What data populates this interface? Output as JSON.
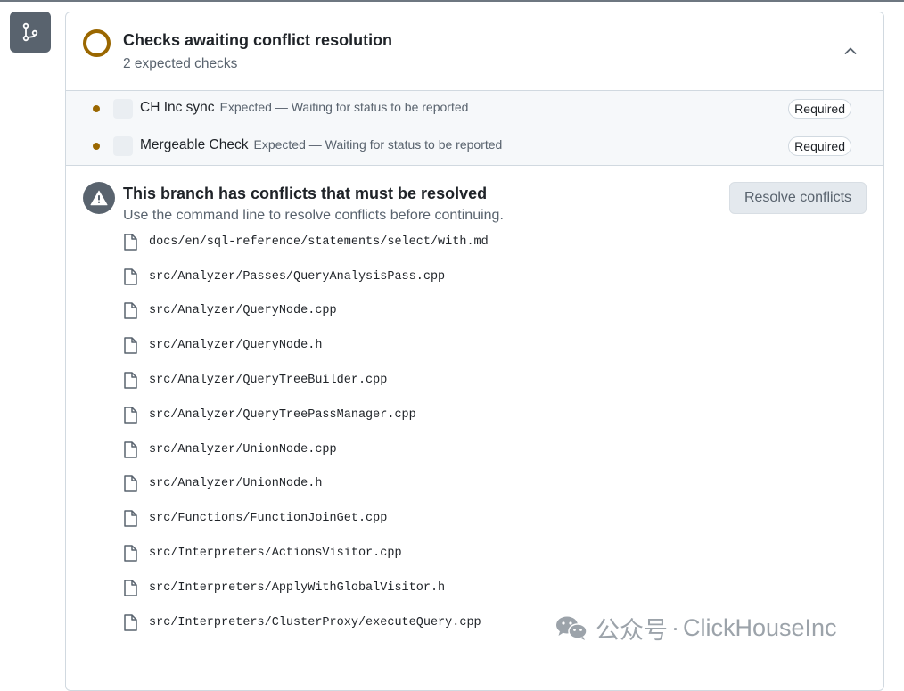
{
  "sidebar": {
    "icon": "git-branch-icon"
  },
  "checks_header": {
    "title": "Checks awaiting conflict resolution",
    "subtitle": "2 expected checks",
    "status_color": "#9a6700",
    "collapse_icon": "chevron-up-icon"
  },
  "checks": [
    {
      "name": "CH Inc sync",
      "status": "Expected — Waiting for status to be reported",
      "badge": "Required"
    },
    {
      "name": "Mergeable Check",
      "status": "Expected — Waiting for status to be reported",
      "badge": "Required"
    }
  ],
  "conflicts": {
    "icon": "alert-icon",
    "title": "This branch has conflicts that must be resolved",
    "subtitle": "Use the command line to resolve conflicts before continuing.",
    "button_label": "Resolve conflicts",
    "files": [
      "docs/en/sql-reference/statements/select/with.md",
      "src/Analyzer/Passes/QueryAnalysisPass.cpp",
      "src/Analyzer/QueryNode.cpp",
      "src/Analyzer/QueryNode.h",
      "src/Analyzer/QueryTreeBuilder.cpp",
      "src/Analyzer/QueryTreePassManager.cpp",
      "src/Analyzer/UnionNode.cpp",
      "src/Analyzer/UnionNode.h",
      "src/Functions/FunctionJoinGet.cpp",
      "src/Interpreters/ActionsVisitor.cpp",
      "src/Interpreters/ApplyWithGlobalVisitor.h",
      "src/Interpreters/ClusterProxy/executeQuery.cpp"
    ]
  },
  "watermark": {
    "prefix": "公众号",
    "separator": "·",
    "name": "ClickHouseInc"
  }
}
